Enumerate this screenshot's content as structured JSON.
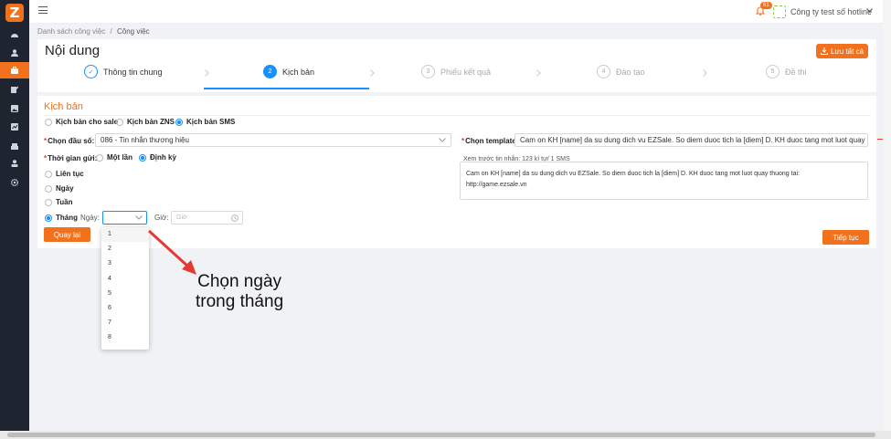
{
  "sidebar": {
    "logo": "Z",
    "icons": [
      "dashboard-icon",
      "user-icon",
      "briefcase-icon",
      "edit-icon",
      "image-icon",
      "chart-icon",
      "building-icon",
      "user-group-icon",
      "gear-icon"
    ],
    "active_index": 2
  },
  "topbar": {
    "notification_count": "61",
    "company": "Công ty test số hotline"
  },
  "breadcrumb": {
    "parent": "Danh sách công việc",
    "sep": "/",
    "current": "Công việc"
  },
  "header": {
    "title": "Nội dung",
    "save_all": "Lưu tất cả"
  },
  "steps": [
    {
      "num": "✓",
      "label": "Thông tin chung"
    },
    {
      "num": "2",
      "label": "Kịch bản"
    },
    {
      "num": "3",
      "label": "Phiếu kết quả"
    },
    {
      "num": "4",
      "label": "Đào tạo"
    },
    {
      "num": "5",
      "label": "Đề thi"
    }
  ],
  "section": {
    "title": "Kịch bản"
  },
  "script_types": [
    "Kịch bản cho sale",
    "Kịch bản ZNS",
    "Kịch bản SMS"
  ],
  "form": {
    "head_label": "Chọn đầu số:",
    "head_value": "086 - Tin nhắn thương hiệu",
    "template_label": "Chọn template:",
    "template_value": "Cam on KH [name] da su dung dich vu EZSale. So diem duoc tich la [diem] D. KH duoc tang mot luot quay thuong tai:",
    "preview_label": "Xem trước tin nhắn: 123 kí tự/ 1 SMS",
    "preview_line1": "Cam on KH [name] da su dung dich vu EZSale. So diem duoc tich la [diem] D. KH duoc tang mot luot quay thuong tai:",
    "preview_line2": "http://game.ezsale.vn",
    "send_time_label": "Thời gian gửi:",
    "once": "Một lần",
    "periodic": "Định kỳ",
    "freq": [
      "Liên tục",
      "Ngày",
      "Tuần",
      "Tháng"
    ],
    "day_label": "Ngày:",
    "time_label": "Giờ:",
    "time_placeholder": "Giờ"
  },
  "buttons": {
    "back": "Quay lại",
    "next": "Tiếp tục"
  },
  "day_options": [
    "1",
    "2",
    "3",
    "4",
    "5",
    "6",
    "7",
    "8"
  ],
  "annotation": {
    "line1": "Chọn ngày",
    "line2": "trong tháng"
  },
  "colors": {
    "accent": "#f2711c",
    "primary": "#1890ff",
    "arrow": "#e53935",
    "sidebar": "#1e2430"
  }
}
